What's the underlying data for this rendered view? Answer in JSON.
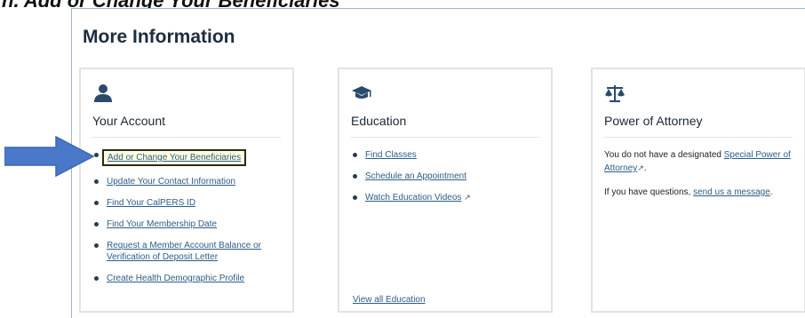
{
  "slide": {
    "title": "n. Add or Change Your Beneficiaries"
  },
  "section": {
    "heading": "More Information"
  },
  "cards": [
    {
      "icon": "person-icon",
      "title": "Your Account",
      "links": [
        "Add or Change Your Beneficiaries",
        "Update Your Contact Information",
        "Find Your CalPERS ID",
        "Find Your Membership Date",
        "Request a Member Account Balance or Verification of Deposit Letter",
        "Create Health Demographic Profile"
      ]
    },
    {
      "icon": "graduation-cap-icon",
      "title": "Education",
      "links": [
        "Find Classes",
        "Schedule an Appointment",
        "Watch Education Videos"
      ],
      "external_marker": "↗",
      "footer_link": "View all Education"
    },
    {
      "icon": "scales-icon",
      "title": "Power of Attorney",
      "para1_text": "You do not have a designated ",
      "para1_link": "Special Power of Attorney",
      "para1_end": ".",
      "para2_text": "If you have questions, ",
      "para2_link": "send us a message",
      "para2_end": "."
    }
  ],
  "colors": {
    "link": "#2c5d87",
    "arrow": "#4a78c8",
    "highlight_bg": "#fdfde0"
  }
}
